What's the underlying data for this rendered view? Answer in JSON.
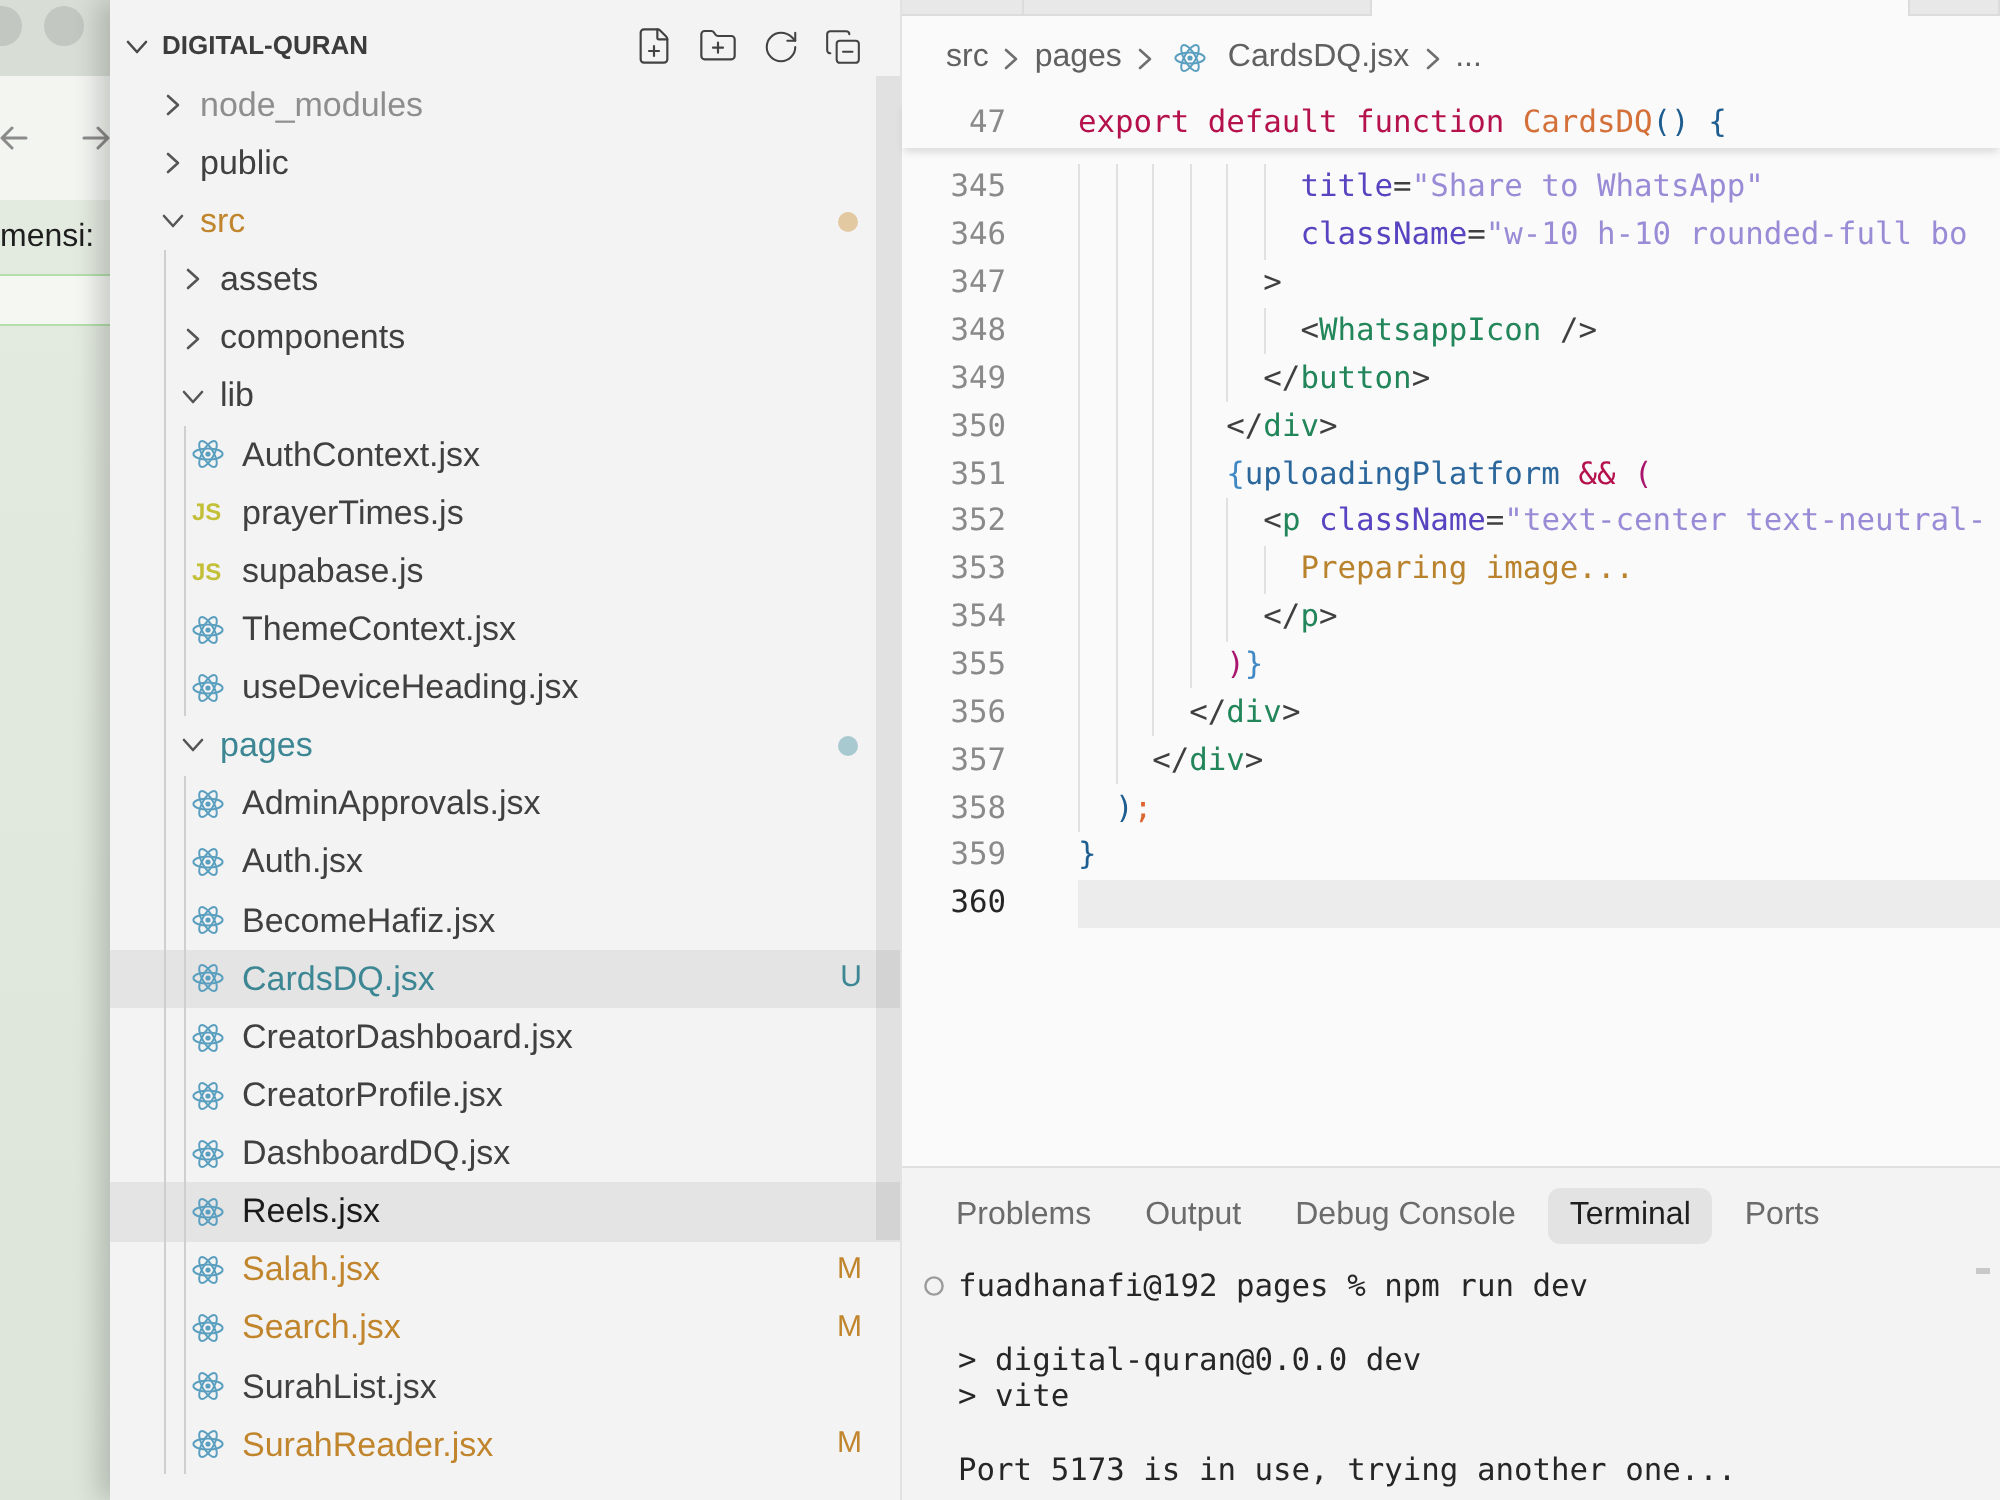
{
  "background_window": {
    "field_label": "mensi:"
  },
  "explorer": {
    "title": "DIGITAL-QURAN",
    "expanded": true,
    "tree": [
      {
        "name": "node_modules",
        "kind": "folder",
        "expanded": false,
        "selected": false,
        "color": "#8e8e8e"
      },
      {
        "name": "public",
        "kind": "folder",
        "expanded": false,
        "selected": false
      },
      {
        "name": "src",
        "kind": "folder",
        "expanded": true,
        "selected": false,
        "color": "#c1862d",
        "children": [
          {
            "name": "assets",
            "kind": "folder",
            "expanded": false,
            "selected": false
          },
          {
            "name": "components",
            "kind": "folder",
            "expanded": false,
            "selected": false
          },
          {
            "name": "lib",
            "kind": "folder",
            "expanded": true,
            "selected": false,
            "children": [
              {
                "name": "AuthContext.jsx",
                "kind": "jsx",
                "selected": false
              },
              {
                "name": "prayerTimes.js",
                "kind": "js",
                "type_label": "JS",
                "selected": false
              },
              {
                "name": "supabase.js",
                "kind": "js",
                "type_label": "JS",
                "selected": false
              },
              {
                "name": "ThemeContext.jsx",
                "kind": "jsx",
                "selected": false
              },
              {
                "name": "useDeviceHeading.jsx",
                "kind": "jsx",
                "selected": false
              }
            ]
          },
          {
            "name": "pages",
            "kind": "folder",
            "expanded": true,
            "selected": false,
            "color": "#3d8794",
            "children": [
              {
                "name": "AdminApprovals.jsx",
                "kind": "jsx",
                "selected": false
              },
              {
                "name": "Auth.jsx",
                "kind": "jsx",
                "selected": false
              },
              {
                "name": "BecomeHafiz.jsx",
                "kind": "jsx",
                "selected": false
              },
              {
                "name": "CardsDQ.jsx",
                "kind": "jsx",
                "selected": true,
                "color": "#3d8794",
                "badge": "U"
              },
              {
                "name": "CreatorDashboard.jsx",
                "kind": "jsx",
                "selected": false
              },
              {
                "name": "CreatorProfile.jsx",
                "kind": "jsx",
                "selected": false
              },
              {
                "name": "DashboardDQ.jsx",
                "kind": "jsx",
                "selected": false
              },
              {
                "name": "Reels.jsx",
                "kind": "jsx",
                "selected": true
              },
              {
                "name": "Salah.jsx",
                "kind": "jsx",
                "selected": false,
                "color": "#c1862d",
                "badge": "M"
              },
              {
                "name": "Search.jsx",
                "kind": "jsx",
                "selected": false,
                "color": "#c1862d",
                "badge": "M"
              },
              {
                "name": "SurahList.jsx",
                "kind": "jsx",
                "selected": false
              },
              {
                "name": "SurahReader.jsx",
                "kind": "jsx",
                "selected": false,
                "color": "#c1862d",
                "badge": "M"
              }
            ]
          }
        ]
      }
    ]
  },
  "editor": {
    "tabs": [
      {
        "selected": false
      },
      {
        "selected": false
      },
      {
        "selected": true
      },
      {
        "selected": false
      }
    ],
    "breadcrumb": [
      {
        "label": "src",
        "kind": "folder"
      },
      {
        "label": "pages",
        "kind": "folder"
      },
      {
        "label": "CardsDQ.jsx",
        "kind": "jsx"
      },
      {
        "label": "...",
        "kind": "symbol"
      }
    ],
    "sticky_line": {
      "number": "47",
      "tokens": [
        {
          "kind": "keyword",
          "text": "export default function "
        },
        {
          "kind": "function",
          "text": "CardsDQ"
        },
        {
          "kind": "bracket_1",
          "text": "() {"
        }
      ]
    },
    "lines": [
      {
        "number": "345",
        "current": false,
        "tokens": [
          {
            "kind": "attribute",
            "text": "            title"
          },
          {
            "kind": "operator",
            "text": "="
          },
          {
            "kind": "string",
            "text": "\"Share to WhatsApp\""
          }
        ]
      },
      {
        "number": "346",
        "current": false,
        "tokens": [
          {
            "kind": "attribute",
            "text": "            className"
          },
          {
            "kind": "operator",
            "text": "="
          },
          {
            "kind": "string",
            "text": "\"w-10 h-10 rounded-full bo"
          }
        ]
      },
      {
        "number": "347",
        "current": false,
        "tokens": [
          {
            "kind": "operator",
            "text": "          >"
          }
        ]
      },
      {
        "number": "348",
        "current": false,
        "tokens": [
          {
            "kind": "operator",
            "text": "            <"
          },
          {
            "kind": "tag",
            "text": "WhatsappIcon"
          },
          {
            "kind": "operator",
            "text": " />"
          }
        ]
      },
      {
        "number": "349",
        "current": false,
        "tokens": [
          {
            "kind": "operator",
            "text": "          </"
          },
          {
            "kind": "tag",
            "text": "button"
          },
          {
            "kind": "operator",
            "text": ">"
          }
        ]
      },
      {
        "number": "350",
        "current": false,
        "tokens": [
          {
            "kind": "operator",
            "text": "        </"
          },
          {
            "kind": "tag",
            "text": "div"
          },
          {
            "kind": "operator",
            "text": ">"
          }
        ]
      },
      {
        "number": "351",
        "current": false,
        "tokens": [
          {
            "kind": "bracket_2",
            "text": "        {"
          },
          {
            "kind": "variable",
            "text": "uploadingPlatform "
          },
          {
            "kind": "keyword",
            "text": "&& "
          },
          {
            "kind": "bracket_3",
            "text": "("
          }
        ]
      },
      {
        "number": "352",
        "current": false,
        "tokens": [
          {
            "kind": "operator",
            "text": "          <"
          },
          {
            "kind": "tag",
            "text": "p "
          },
          {
            "kind": "attribute",
            "text": "className"
          },
          {
            "kind": "operator",
            "text": "="
          },
          {
            "kind": "string",
            "text": "\"text-center text-neutral-"
          }
        ]
      },
      {
        "number": "353",
        "current": false,
        "tokens": [
          {
            "kind": "text",
            "text": "            Preparing image..."
          }
        ]
      },
      {
        "number": "354",
        "current": false,
        "tokens": [
          {
            "kind": "operator",
            "text": "          </"
          },
          {
            "kind": "tag",
            "text": "p"
          },
          {
            "kind": "operator",
            "text": ">"
          }
        ]
      },
      {
        "number": "355",
        "current": false,
        "tokens": [
          {
            "kind": "bracket_3",
            "text": "        )"
          },
          {
            "kind": "bracket_2",
            "text": "}"
          }
        ]
      },
      {
        "number": "356",
        "current": false,
        "tokens": [
          {
            "kind": "operator",
            "text": "      </"
          },
          {
            "kind": "tag",
            "text": "div"
          },
          {
            "kind": "operator",
            "text": ">"
          }
        ]
      },
      {
        "number": "357",
        "current": false,
        "tokens": [
          {
            "kind": "operator",
            "text": "    </"
          },
          {
            "kind": "tag",
            "text": "div"
          },
          {
            "kind": "operator",
            "text": ">"
          }
        ]
      },
      {
        "number": "358",
        "current": false,
        "tokens": [
          {
            "kind": "bracket_1",
            "text": "  )"
          },
          {
            "kind": "semicolon",
            "text": ";"
          }
        ]
      },
      {
        "number": "359",
        "current": false,
        "tokens": [
          {
            "kind": "bracket_1",
            "text": "}"
          }
        ]
      },
      {
        "number": "360",
        "current": true
      }
    ]
  },
  "panel": {
    "tabs": [
      {
        "label": "Problems",
        "selected": false
      },
      {
        "label": "Output",
        "selected": false
      },
      {
        "label": "Debug Console",
        "selected": false
      },
      {
        "label": "Terminal",
        "selected": true
      },
      {
        "label": "Ports",
        "selected": false
      }
    ],
    "terminal_lines": [
      {
        "kind": "command",
        "text": "fuadhanafi@192 pages % npm run dev"
      },
      {
        "kind": "blank"
      },
      {
        "kind": "output",
        "text": "> digital-quran@0.0.0 dev"
      },
      {
        "kind": "output",
        "text": "> vite"
      },
      {
        "kind": "blank"
      },
      {
        "kind": "output",
        "text": "Port 5173 is in use, trying another one..."
      }
    ]
  }
}
